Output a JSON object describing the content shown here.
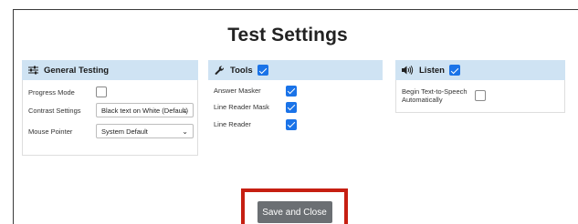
{
  "title": "Test Settings",
  "general": {
    "header": "General Testing",
    "progress_mode_label": "Progress Mode",
    "progress_mode_checked": false,
    "contrast_label": "Contrast Settings",
    "contrast_value": "Black text on White (Default)",
    "pointer_label": "Mouse Pointer",
    "pointer_value": "System Default",
    "header_icon": "sliders-icon"
  },
  "tools": {
    "header": "Tools",
    "header_checked": true,
    "header_icon": "wrench-icon",
    "items": [
      {
        "label": "Answer Masker",
        "checked": true
      },
      {
        "label": "Line Reader Mask",
        "checked": true
      },
      {
        "label": "Line Reader",
        "checked": true
      }
    ]
  },
  "listen": {
    "header": "Listen",
    "header_checked": true,
    "header_icon": "speaker-icon",
    "tts_label_line1": "Begin Text-to-Speech",
    "tts_label_line2": "Automatically",
    "tts_checked": false
  },
  "save_button": "Save and Close",
  "colors": {
    "header_bg": "#cfe3f3",
    "checkbox_on": "#1a73e8",
    "button_bg": "#6b6f73",
    "highlight_border": "#c61f12"
  }
}
